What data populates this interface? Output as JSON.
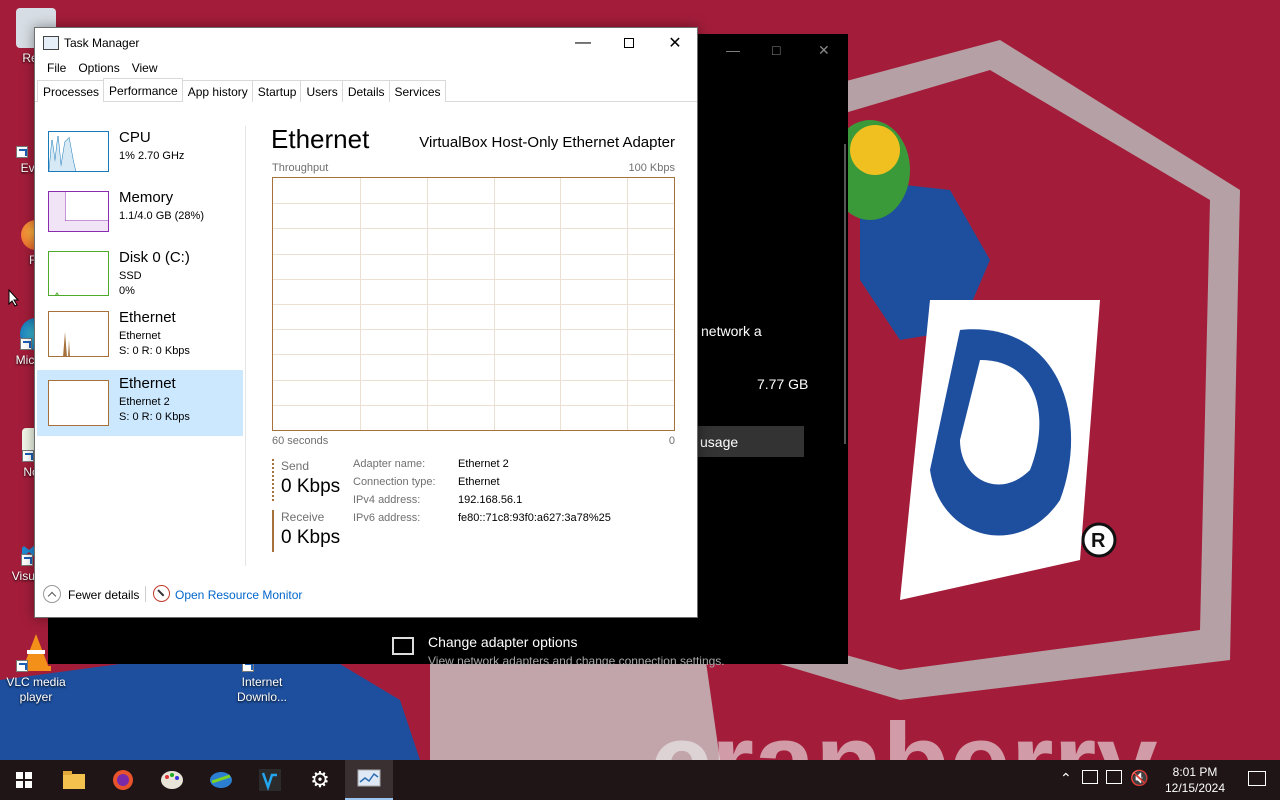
{
  "desktop": {
    "icons": [
      {
        "label": "Recy",
        "icon": "recycle-bin-icon"
      },
      {
        "label": "Every",
        "icon": "everything-icon"
      },
      {
        "label": "Fir",
        "icon": "firefox-icon"
      },
      {
        "label": "Micr Ed",
        "icon": "edge-icon"
      },
      {
        "label": "Note",
        "icon": "notepad-icon"
      },
      {
        "label": "Visua Co",
        "icon": "vscode-icon"
      },
      {
        "label": "VLC media player",
        "icon": "vlc-icon"
      },
      {
        "label": "Internet Downlo...",
        "icon": "idm-icon"
      }
    ]
  },
  "background_window": {
    "partial_text_1": "network a",
    "partial_text_2": "7.77 GB",
    "usage_button": "usage",
    "change_title": "Change adapter options",
    "change_subtitle": "View network adapters and change connection settings."
  },
  "task_manager": {
    "title": "Task Manager",
    "menu": [
      "File",
      "Options",
      "View"
    ],
    "tabs": [
      "Processes",
      "Performance",
      "App history",
      "Startup",
      "Users",
      "Details",
      "Services"
    ],
    "active_tab": "Performance",
    "sidebar": [
      {
        "name": "CPU",
        "sub1": "1%  2.70 GHz",
        "sub2": "",
        "color": "#1a7ab8"
      },
      {
        "name": "Memory",
        "sub1": "1.1/4.0 GB (28%)",
        "sub2": "",
        "color": "#8b2bb0"
      },
      {
        "name": "Disk 0 (C:)",
        "sub1": "SSD",
        "sub2": "0%",
        "color": "#4daa2b"
      },
      {
        "name": "Ethernet",
        "sub1": "Ethernet",
        "sub2": "S: 0  R: 0 Kbps",
        "color": "#a7713b"
      },
      {
        "name": "Ethernet",
        "sub1": "Ethernet 2",
        "sub2": "S: 0  R: 0 Kbps",
        "color": "#a7713b",
        "selected": true
      }
    ],
    "main": {
      "title": "Ethernet",
      "adapter_description": "VirtualBox Host-Only Ethernet Adapter",
      "graph_label": "Throughput",
      "graph_max": "100 Kbps",
      "time_label": "60 seconds",
      "zero_label": "0",
      "send_label": "Send",
      "send_value": "0 Kbps",
      "receive_label": "Receive",
      "receive_value": "0 Kbps",
      "info": [
        {
          "key": "Adapter name:",
          "value": "Ethernet 2"
        },
        {
          "key": "Connection type:",
          "value": "Ethernet"
        },
        {
          "key": "IPv4 address:",
          "value": "192.168.56.1"
        },
        {
          "key": "IPv6 address:",
          "value": "fe80::71c8:93f0:a627:3a78%25"
        }
      ]
    },
    "footer": {
      "fewer_details": "Fewer details",
      "open_resource_monitor": "Open Resource Monitor"
    }
  },
  "taskbar": {
    "apps": [
      "start-icon",
      "file-explorer-icon",
      "firefox-icon",
      "paint-icon",
      "idm-icon",
      "vscode-icon",
      "settings-icon",
      "task-manager-icon"
    ],
    "clock_time": "8:01 PM",
    "clock_date": "12/15/2024"
  }
}
